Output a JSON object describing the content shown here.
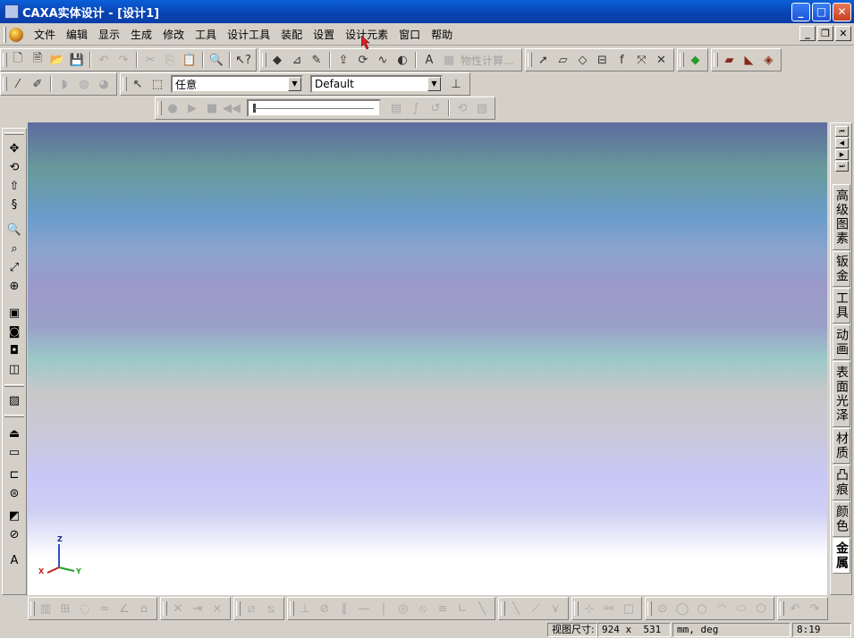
{
  "window": {
    "title": "CAXA实体设计 - [设计1]"
  },
  "menu": {
    "items": [
      "文件",
      "编辑",
      "显示",
      "生成",
      "修改",
      "工具",
      "设计工具",
      "装配",
      "设置",
      "设计元素",
      "窗口",
      "帮助"
    ]
  },
  "toolbar": {
    "selection_filter": {
      "value": "任意"
    },
    "style_combo": {
      "value": "Default"
    },
    "property_calc_label": "物性计算..."
  },
  "right_tabs": [
    {
      "label": "高级图素",
      "active": false
    },
    {
      "label": "钣金",
      "active": false
    },
    {
      "label": "工具",
      "active": false
    },
    {
      "label": "动画",
      "active": false
    },
    {
      "label": "表面光泽",
      "active": false
    },
    {
      "label": "材质",
      "active": false
    },
    {
      "label": "凸痕",
      "active": false
    },
    {
      "label": "颜色",
      "active": false
    },
    {
      "label": "金属",
      "active": true
    }
  ],
  "triad": {
    "x": "X",
    "y": "Y",
    "z": "Z"
  },
  "status": {
    "view_size_label": "视图尺寸:",
    "view_size_value": "924 x  531",
    "units": "mm, deg",
    "time": "8:19"
  },
  "colors": {
    "titlebar": "#0842b0",
    "accent": "#d4d0c8"
  }
}
